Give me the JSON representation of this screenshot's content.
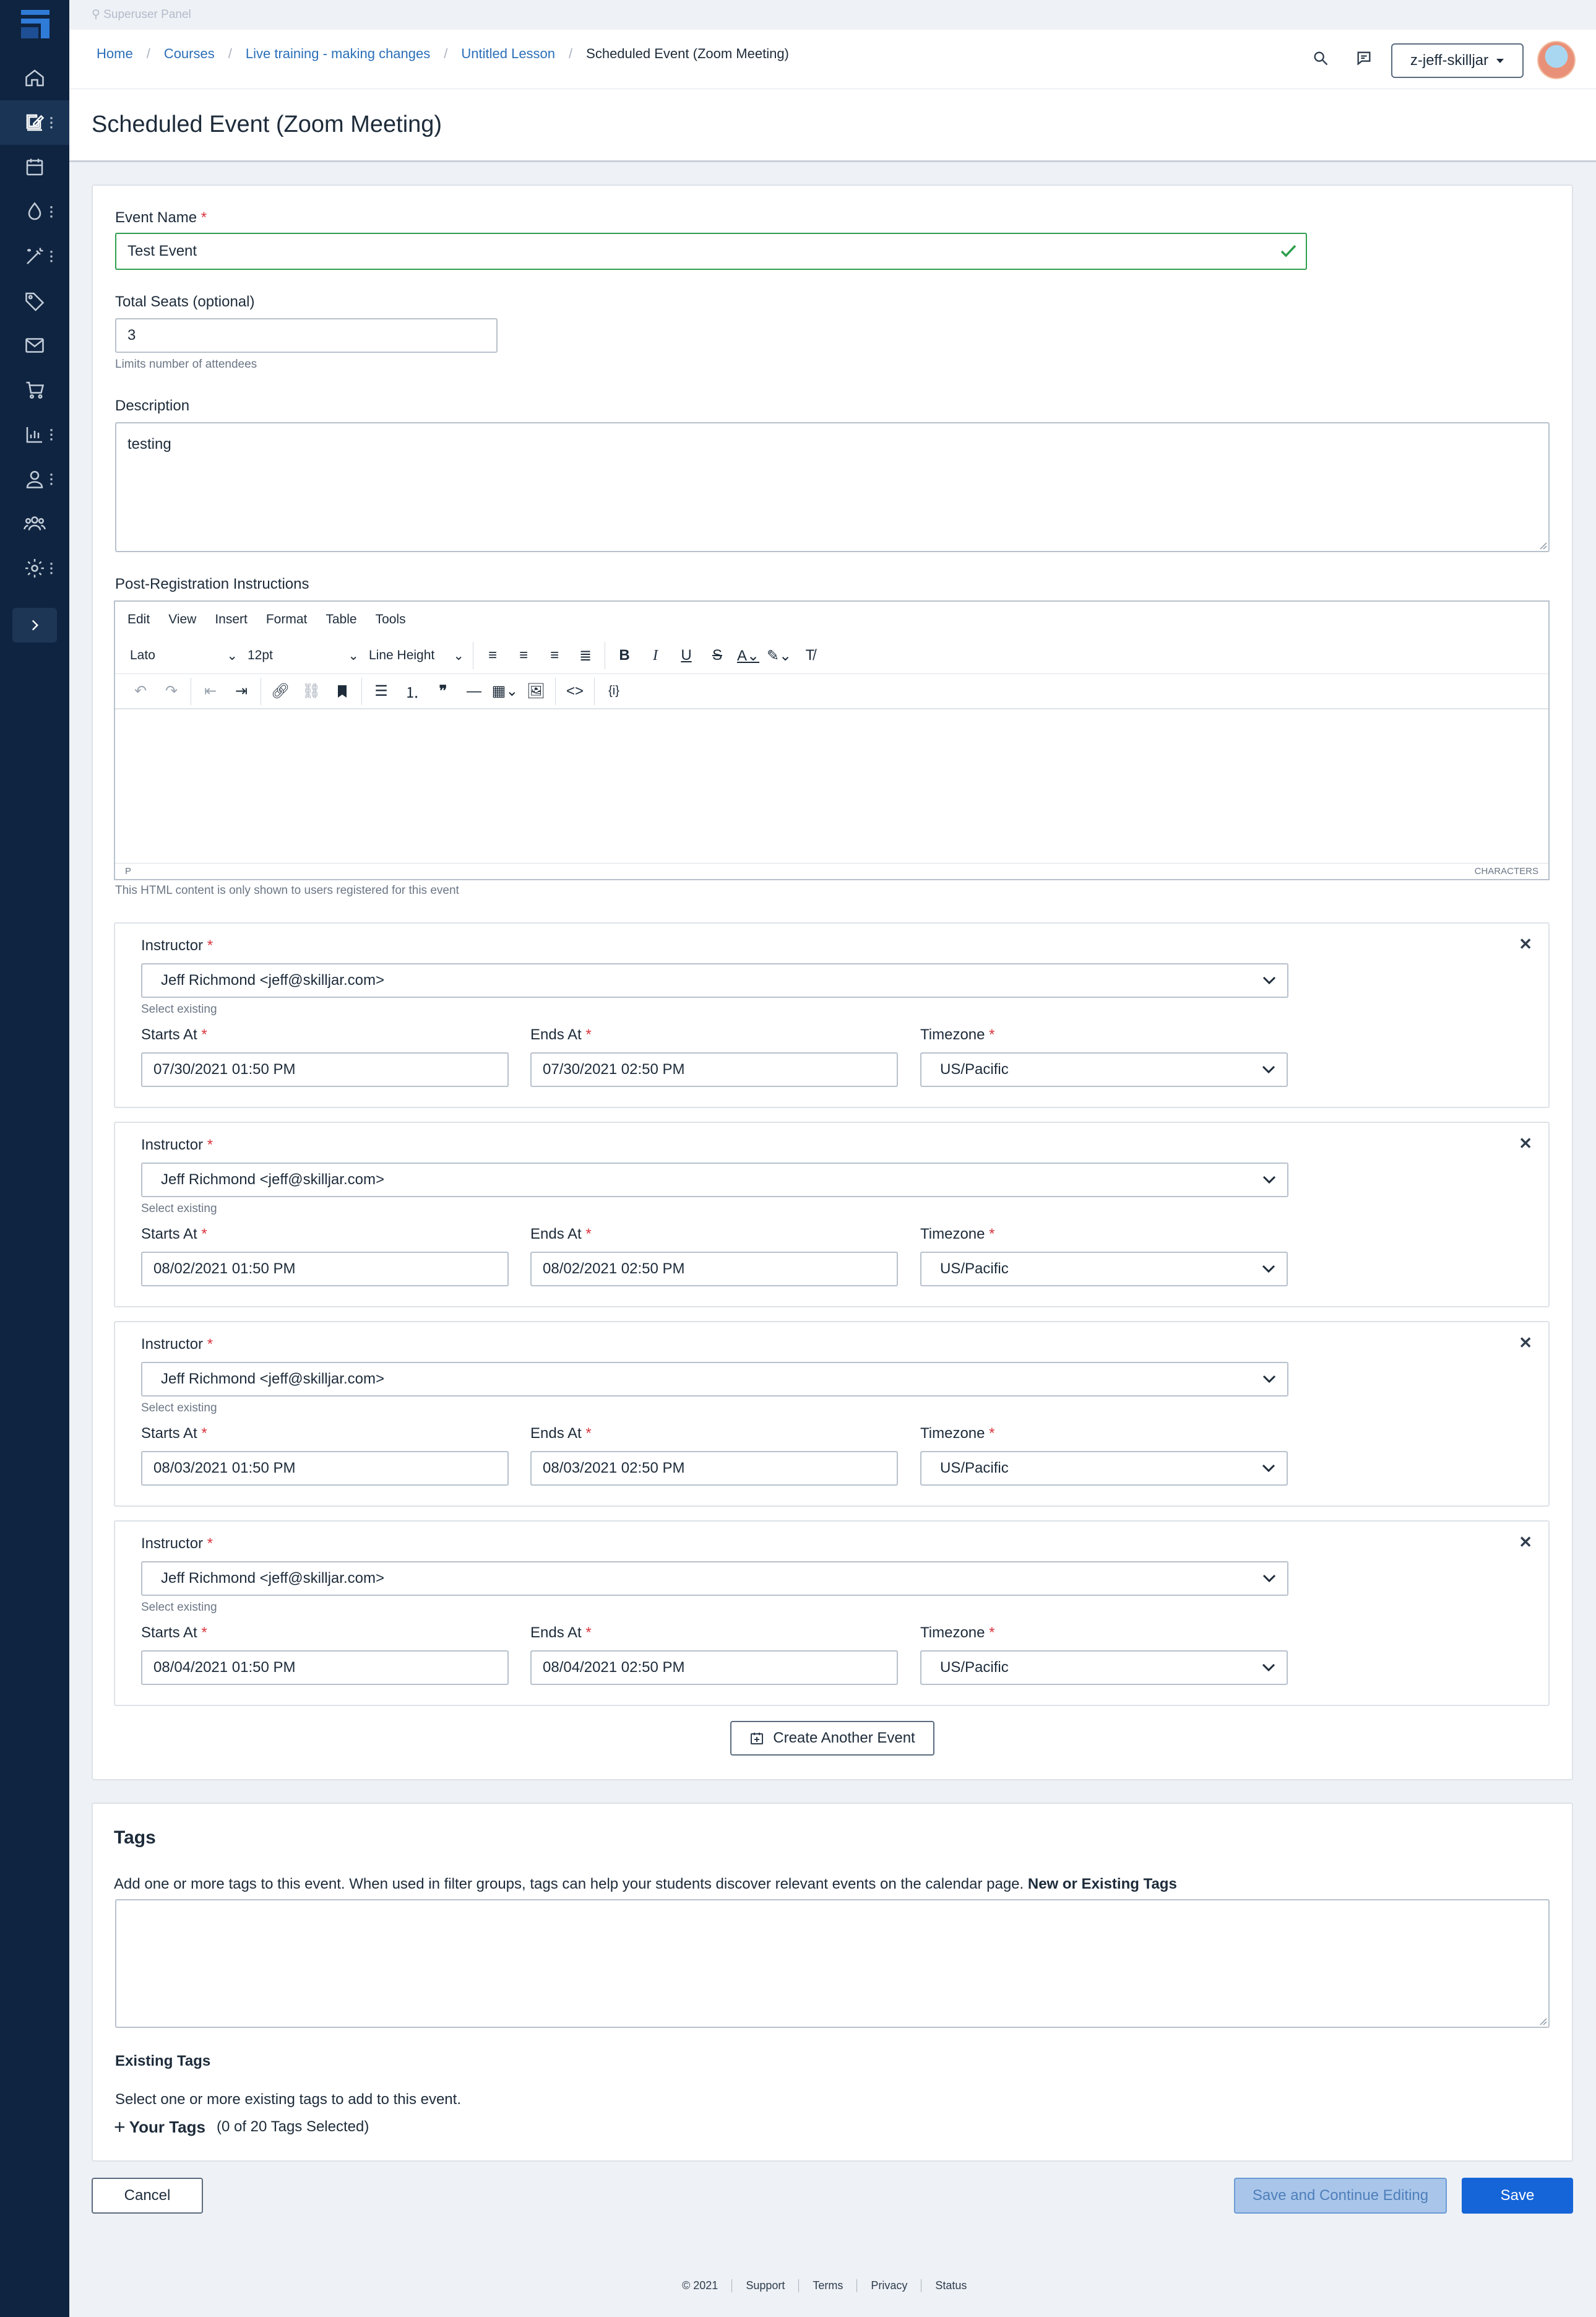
{
  "superuser": {
    "label": "Superuser Panel"
  },
  "breadcrumb": [
    "Home",
    "Courses",
    "Live training - making changes",
    "Untitled Lesson",
    "Scheduled Event (Zoom Meeting)"
  ],
  "account": {
    "name": "z-jeff-skilljar"
  },
  "page": {
    "title": "Scheduled Event (Zoom Meeting)"
  },
  "form": {
    "event_name_label": "Event Name",
    "event_name_value": "Test Event",
    "seats_label": "Total Seats (optional)",
    "seats_value": "3",
    "seats_help": "Limits number of attendees",
    "description_label": "Description",
    "description_value": "testing",
    "post_reg_label": "Post-Registration Instructions",
    "post_reg_help": "This HTML content is only shown to users registered for this event"
  },
  "editor": {
    "menu": [
      "Edit",
      "View",
      "Insert",
      "Format",
      "Table",
      "Tools"
    ],
    "font": "Lato",
    "size": "12pt",
    "line_height": "Line Height",
    "status_path": "P",
    "status_right": "CHARACTERS"
  },
  "event_labels": {
    "instructor": "Instructor",
    "select_existing": "Select existing",
    "starts_at": "Starts At",
    "ends_at": "Ends At",
    "timezone": "Timezone"
  },
  "events": [
    {
      "instructor": "Jeff Richmond <jeff@skilljar.com>",
      "starts": "07/30/2021 01:50 PM",
      "ends": "07/30/2021 02:50 PM",
      "timezone": "US/Pacific"
    },
    {
      "instructor": "Jeff Richmond <jeff@skilljar.com>",
      "starts": "08/02/2021 01:50 PM",
      "ends": "08/02/2021 02:50 PM",
      "timezone": "US/Pacific"
    },
    {
      "instructor": "Jeff Richmond <jeff@skilljar.com>",
      "starts": "08/03/2021 01:50 PM",
      "ends": "08/03/2021 02:50 PM",
      "timezone": "US/Pacific"
    },
    {
      "instructor": "Jeff Richmond <jeff@skilljar.com>",
      "starts": "08/04/2021 01:50 PM",
      "ends": "08/04/2021 02:50 PM",
      "timezone": "US/Pacific"
    }
  ],
  "create_another_label": "Create Another Event",
  "tags": {
    "title": "Tags",
    "desc": "Add one or more tags to this event. When used in filter groups, tags can help your students discover relevant events on the calendar page.",
    "desc_bold": "New or Existing Tags",
    "existing_title": "Existing Tags",
    "existing_desc": "Select one or more existing tags to add to this event.",
    "your_tags": "Your Tags",
    "selected_count": "(0 of 20 Tags Selected)"
  },
  "buttons": {
    "cancel": "Cancel",
    "save_continue": "Save and Continue Editing",
    "save": "Save"
  },
  "footer": [
    "© 2021",
    "Support",
    "Terms",
    "Privacy",
    "Status"
  ],
  "colors": {
    "sidebar": "#0f2440",
    "primary": "#1565d8",
    "valid": "#2e9e4d",
    "required": "#d9363e"
  }
}
